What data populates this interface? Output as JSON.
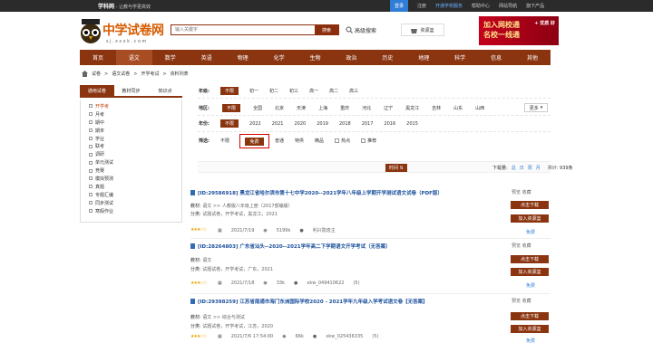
{
  "topbar": {
    "brand": "学科网",
    "slogan": "- 让教与学更高效",
    "links": [
      "登录",
      "注册",
      "开通学校服务",
      "帮助中心",
      "网站导航",
      "旗下产品"
    ]
  },
  "logo": {
    "title": "中学试卷网",
    "url": "sj.zxxk.com"
  },
  "search": {
    "placeholder": "输入关键字",
    "button": "搜索",
    "advanced": "高级搜索",
    "cart": "资源篮"
  },
  "banner": {
    "line1": "加入网校通",
    "line2": "名校一线通",
    "line3": "网校通",
    "badge": "+ 优质 好"
  },
  "nav": [
    "首页",
    "语文",
    "数学",
    "英语",
    "物理",
    "化学",
    "生物",
    "政治",
    "历史",
    "地理",
    "科学",
    "信息",
    "其他"
  ],
  "breadcrumb": [
    "试卷",
    "语文试卷",
    "开学考试",
    "资料列表"
  ],
  "sidetabs": [
    "通用试卷",
    "教材同步",
    "知识点"
  ],
  "categories": [
    "开学考",
    "月考",
    "期中",
    "期末",
    "学业",
    "联考",
    "调研",
    "单元测试",
    "竞赛",
    "模拟预测",
    "真题",
    "专题汇编",
    "同步测试",
    "寒假作业"
  ],
  "filters": {
    "grade": {
      "label": "年级:",
      "options": [
        "不限",
        "初一",
        "初二",
        "初三",
        "高一",
        "高二",
        "高三"
      ]
    },
    "region": {
      "label": "地区:",
      "options": [
        "不限",
        "全国",
        "北京",
        "天津",
        "上海",
        "重庆",
        "河北",
        "辽宁",
        "黑龙江",
        "吉林",
        "山东",
        "山西"
      ],
      "more": "更多"
    },
    "year": {
      "label": "年份:",
      "options": [
        "不限",
        "2022",
        "2021",
        "2020",
        "2019",
        "2018",
        "2017",
        "2016",
        "2015"
      ]
    },
    "filter": {
      "label": "筛选:",
      "options": [
        "不限",
        "免费",
        "普通",
        "特供",
        "精品"
      ],
      "checks": [
        "热点",
        "推荐"
      ]
    }
  },
  "sortbar": {
    "time": "时间",
    "download": "下载量:",
    "opts": [
      "总",
      "日",
      "周",
      "月"
    ],
    "total": "共计: 939条"
  },
  "items": [
    {
      "title": "[ID:29586918] 黑龙江省哈尔滨市第十七中学2020--2021学年八年级上学期开学测试语文试卷（PDF版）",
      "m1k": "教材:",
      "m1v": "语文 >> 人教版八年级上册（2017部编版）",
      "m2k": "分类:",
      "m2v": "试题试卷，开学考试，黑龙江，2021",
      "date": "2021/7/19",
      "views": "5199k",
      "user": "利兴隐逸主",
      "score": "(5)",
      "action": "预览 收藏",
      "dl": "点击下载",
      "basket": "加入资源篮",
      "free": "免费"
    },
    {
      "title": "[ID:28264803] 广东省汕头--2020--2021学年高二下学期语文开学考试（无答案）",
      "m1k": "教材:",
      "m1v": "语文",
      "m2k": "分类:",
      "m2v": "试题试卷，开学考试，广东，2021",
      "date": "2021/7/18",
      "views": "33k",
      "user": "xkw_049410622",
      "score": "(5)",
      "action": "预览 收藏",
      "dl": "点击下载",
      "basket": "加入资源篮",
      "free": "免费"
    },
    {
      "title": "[ID:29398259] 江苏省南通市海门东洲国际学校2020 - 2021学年九年级入学考试语文卷【无答案】",
      "m1k": "教材:",
      "m1v": "语文 >> 综合与测试",
      "m2k": "分类:",
      "m2v": "试题试卷，开学考试，江苏，2020",
      "date": "2021/7/6 17:54:00",
      "views": "66k",
      "user": "xkw_025436335",
      "score": "(5)",
      "action": "预览 收藏",
      "dl": "点击下载",
      "basket": "加入资源篮",
      "free": "免费"
    }
  ]
}
